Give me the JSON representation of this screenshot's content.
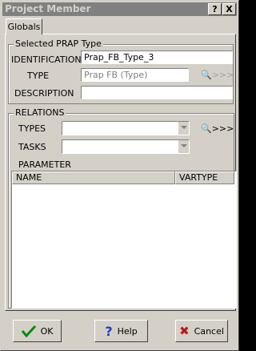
{
  "window": {
    "title": "Project Member",
    "help_button": "?",
    "close_button": "X"
  },
  "tabs": [
    {
      "label": "Globals"
    }
  ],
  "selected_type": {
    "legend": "Selected PRAP Type",
    "identification_label": "IDENTIFICATION",
    "identification_value": "Prap_FB_Type_3",
    "type_label": "TYPE",
    "type_value": "Prap FB (Type)",
    "description_label": "DESCRIPTION",
    "description_value": ""
  },
  "relations": {
    "legend": "RELATIONS",
    "types_label": "TYPES",
    "tasks_label": "TASKS",
    "parameter_label": "PARAMETER",
    "columns": [
      "NAME",
      "VARTYPE"
    ],
    "rows": []
  },
  "lookup": {
    "chevrons": ">>>"
  },
  "buttons": {
    "ok": "OK",
    "help": "Help",
    "cancel": "Cancel"
  }
}
